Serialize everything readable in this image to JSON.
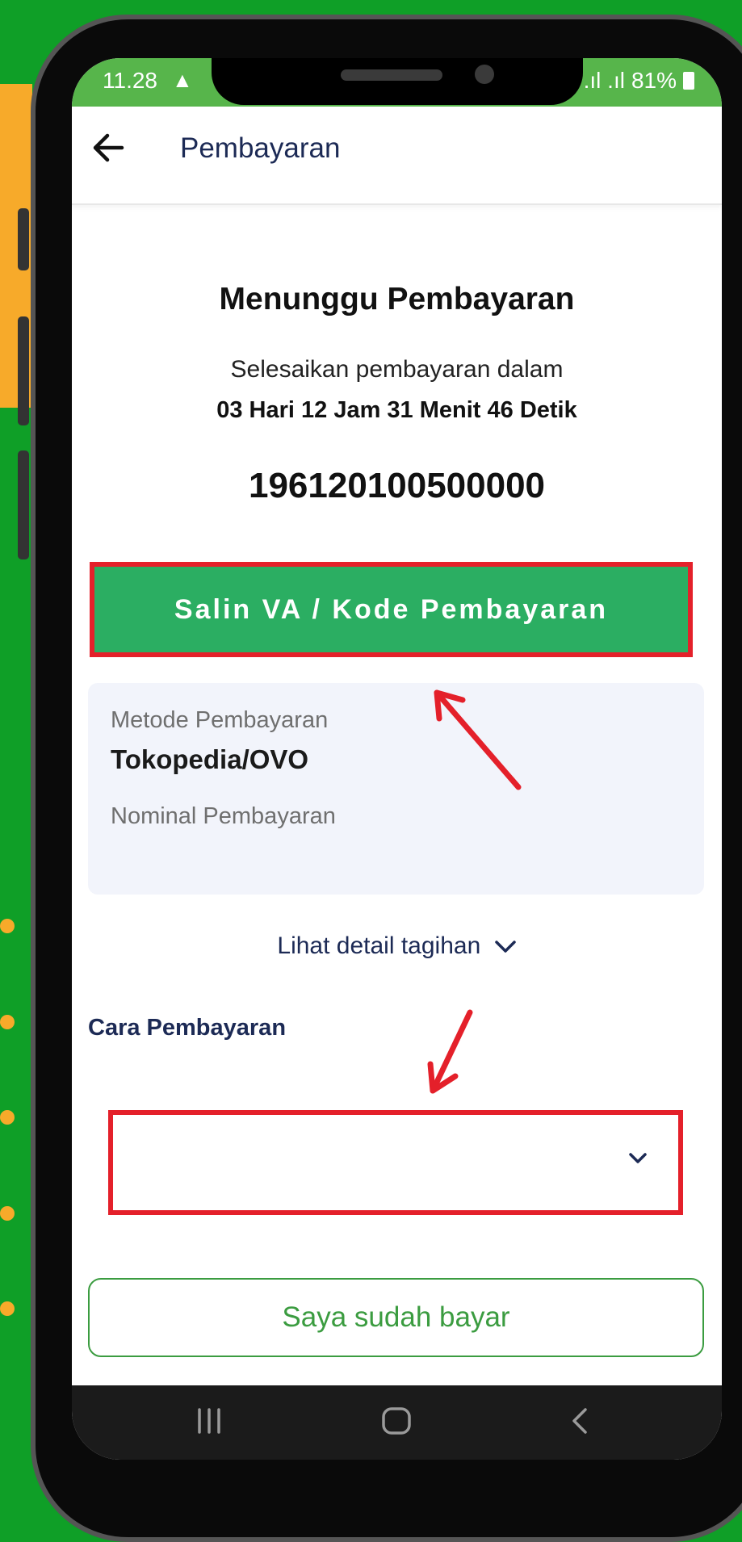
{
  "status_bar": {
    "time": "11.28",
    "alert_icon": "warning-icon",
    "signal": ".ıl .ıl",
    "battery": "81%"
  },
  "header": {
    "back_icon": "arrow-left-icon",
    "title": "Pembayaran"
  },
  "payment": {
    "title": "Menunggu Pembayaran",
    "subtitle": "Selesaikan pembayaran dalam",
    "countdown": "03 Hari 12 Jam 31 Menit 46 Detik",
    "va_code": "196120100500000",
    "copy_button": "Salin VA / Kode Pembayaran"
  },
  "info": {
    "method_label": "Metode Pembayaran",
    "method_value": "Tokopedia/OVO",
    "amount_label": "Nominal Pembayaran"
  },
  "detail_link": "Lihat detail tagihan",
  "cara": {
    "label": "Cara Pembayaran",
    "select_value": ""
  },
  "paid_button": "Saya sudah bayar",
  "colors": {
    "background": "#0f9f27",
    "accent_orange": "#f7aa2a",
    "primary_green": "#2bae62",
    "highlight_red": "#e4202a",
    "navy": "#1c2a55"
  }
}
